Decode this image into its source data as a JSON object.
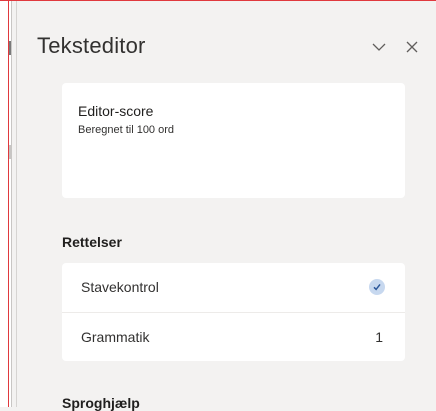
{
  "panel": {
    "title": "Teksteditor",
    "score": {
      "title": "Editor-score",
      "subtitle": "Beregnet til 100 ord"
    },
    "corrections": {
      "heading": "Rettelser",
      "items": [
        {
          "label": "Stavekontrol",
          "status_icon": "check-icon"
        },
        {
          "label": "Grammatik",
          "count": "1"
        }
      ]
    },
    "next_heading": "Sproghjælp"
  },
  "colors": {
    "accent": "#2b579a",
    "badge": "#c7d8ef",
    "background": "#f3f2f1"
  }
}
